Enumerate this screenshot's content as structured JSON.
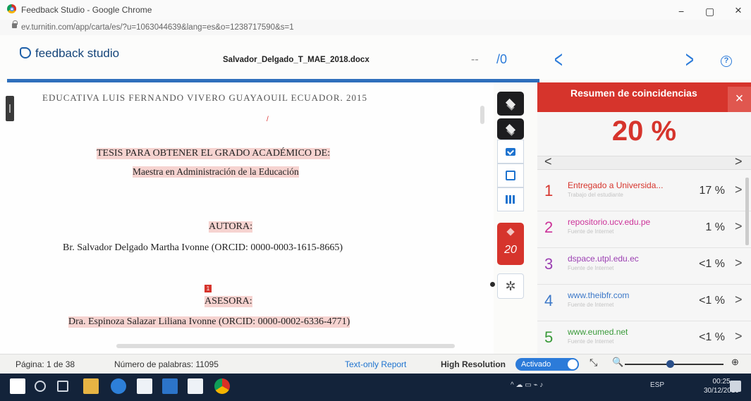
{
  "window": {
    "title": "Feedback Studio - Google Chrome",
    "url": "ev.turnitin.com/app/carta/es/?u=1063044639&lang=es&o=1238717590&s=1",
    "minimize": "−",
    "maximize": "▢",
    "close": "×"
  },
  "header": {
    "app_name": "feedback studio",
    "doc_name": "Salvador_Delgado_T_MAE_2018.docx",
    "page_dash": "--",
    "page_total": "/0",
    "prev": "<",
    "next": ">",
    "help": "?"
  },
  "document": {
    "top_cut": "EDUCATIVA LUIS FERNANDO VIVERO GUAYAQUIL ECUADOR, 2015",
    "red_mark": "/",
    "line1": "TESIS PARA OBTENER EL GRADO ACADÉMICO DE:",
    "line2": "Maestra en Administración de la Educación",
    "autora_label": "AUTORA:",
    "autora_name": "Br. Salvador Delgado Martha Ivonne (ORCID: 0000-0003-1615-8665)",
    "marker": "1",
    "asesora_label": "ASESORA:",
    "asesora_name": "Dra. Espinoza Salazar Liliana Ivonne (ORCID: 0000-0002-6336-4771)"
  },
  "tools": {
    "similarity_score": "20",
    "gear": "✲"
  },
  "panel": {
    "title": "Resumen de coincidencias",
    "close": "×",
    "score": "20 %",
    "prev": "<",
    "next": ">",
    "matches": [
      {
        "num": "1",
        "source": "Entregado a Universida...",
        "type": "Trabajo del estudiante",
        "pct": "17 %",
        "color": "#d6342c"
      },
      {
        "num": "2",
        "source": "repositorio.ucv.edu.pe",
        "type": "Fuente de Internet",
        "pct": "1 %",
        "color": "#cc3399"
      },
      {
        "num": "3",
        "source": "dspace.utpl.edu.ec",
        "type": "Fuente de Internet",
        "pct": "<1 %",
        "color": "#9b3fb2"
      },
      {
        "num": "4",
        "source": "www.theibfr.com",
        "type": "Fuente de Internet",
        "pct": "<1 %",
        "color": "#3c78c8"
      },
      {
        "num": "5",
        "source": "www.eumed.net",
        "type": "Fuente de Internet",
        "pct": "<1 %",
        "color": "#3a9a3a"
      }
    ]
  },
  "status": {
    "page": "Página: 1 de 38",
    "words": "Número de palabras: 11095",
    "text_only": "Text-only Report",
    "high_res": "High Resolution",
    "toggle_label": "Activado",
    "zoom_out": "🔍",
    "zoom_in": "⊕",
    "zoom_level": 0.46
  },
  "taskbar": {
    "lang": "ESP",
    "time": "00:25",
    "date": "30/12/2019"
  }
}
